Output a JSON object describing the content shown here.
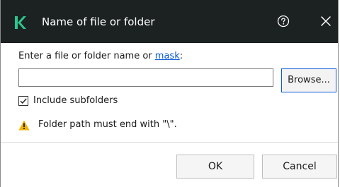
{
  "window": {
    "title": "Name of file or folder",
    "icons": {
      "app": "kaspersky-k-icon",
      "help": "question-circle-icon",
      "close": "close-icon"
    },
    "colors": {
      "titlebar_bg": "#1c2222",
      "logo_green": "#29c88f",
      "link": "#0a5ad6",
      "warning": "#f0b400"
    }
  },
  "form": {
    "label_prefix": "Enter a file or folder name or ",
    "label_link": "mask",
    "label_suffix": ":",
    "name_value": "",
    "browse_label": "Browse...",
    "include_subfolders": {
      "label": "Include subfolders",
      "checked": true
    },
    "warning": "Folder path must end with \"\\\"."
  },
  "footer": {
    "ok_label": "OK",
    "cancel_label": "Cancel"
  }
}
